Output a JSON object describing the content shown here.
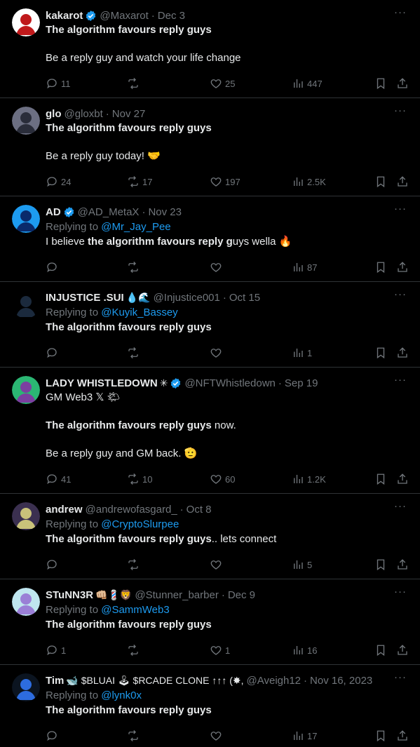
{
  "tweets": [
    {
      "name": "kakarot",
      "emojis": "",
      "verified": true,
      "handle": "@Maxarot",
      "date": "Dec 3",
      "avatar_color": "#c0191b",
      "avatar_bg": "#ffffff",
      "replying_to": "",
      "lines": [
        {
          "segments": [
            {
              "t": "The algorithm favours reply guys",
              "b": true
            }
          ]
        },
        {
          "segments": []
        },
        {
          "segments": [
            {
              "t": "Be a reply guy and watch your life change",
              "b": false
            }
          ]
        }
      ],
      "replies": "11",
      "reposts": "",
      "likes": "25",
      "views": "447"
    },
    {
      "name": "glo",
      "emojis": "",
      "verified": false,
      "handle": "@gloxbt",
      "date": "Nov 27",
      "avatar_color": "#2a2d3a",
      "avatar_bg": "#6c6f82",
      "replying_to": "",
      "lines": [
        {
          "segments": [
            {
              "t": "The algorithm favours reply guys",
              "b": true
            }
          ]
        },
        {
          "segments": []
        },
        {
          "segments": [
            {
              "t": "Be a reply guy today! 🤝",
              "b": false
            }
          ]
        }
      ],
      "replies": "24",
      "reposts": "17",
      "likes": "197",
      "views": "2.5K"
    },
    {
      "name": "AD",
      "emojis": "",
      "verified": true,
      "handle": "@AD_MetaX",
      "date": "Nov 23",
      "avatar_color": "#0a2a6b",
      "avatar_bg": "#1d9bf0",
      "replying_to": "@Mr_Jay_Pee",
      "lines": [
        {
          "segments": [
            {
              "t": "I believe ",
              "b": false
            },
            {
              "t": "the algorithm favours reply g",
              "b": true
            },
            {
              "t": "uys wella 🔥",
              "b": false
            }
          ]
        }
      ],
      "replies": "",
      "reposts": "",
      "likes": "",
      "views": "87"
    },
    {
      "name": "INJUSTICE .SUI",
      "emojis": "💧🌊",
      "verified": false,
      "handle": "@Injustice001",
      "date": "Oct 15",
      "avatar_color": "#1b2a3d",
      "avatar_bg": "#000000",
      "replying_to": "@Kuyik_Bassey",
      "lines": [
        {
          "segments": [
            {
              "t": "The algorithm favours reply guys",
              "b": true
            }
          ]
        }
      ],
      "replies": "",
      "reposts": "",
      "likes": "",
      "views": "1"
    },
    {
      "name": "LADY WHISTLEDOWN",
      "emojis": "✳",
      "verified": true,
      "handle": "@NFTWhistledown",
      "date": "Sep 19",
      "avatar_color": "#7b3fa0",
      "avatar_bg": "#2bb673",
      "replying_to": "",
      "lines": [
        {
          "segments": [
            {
              "t": "GM Web3 𝕏 🌤",
              "b": false
            }
          ]
        },
        {
          "segments": []
        },
        {
          "segments": [
            {
              "t": "The algorithm favours reply guys",
              "b": true
            },
            {
              "t": " now.",
              "b": false
            }
          ]
        },
        {
          "segments": []
        },
        {
          "segments": [
            {
              "t": "Be a reply guy and GM back. 🫡",
              "b": false
            }
          ]
        }
      ],
      "replies": "41",
      "reposts": "10",
      "likes": "60",
      "views": "1.2K"
    },
    {
      "name": "andrew",
      "emojis": "",
      "verified": false,
      "handle": "@andrewofasgard_",
      "date": "Oct 8",
      "avatar_color": "#c9c27a",
      "avatar_bg": "#3b3050",
      "replying_to": "@CryptoSlurpee",
      "lines": [
        {
          "segments": [
            {
              "t": "The algorithm favours reply guys",
              "b": true
            },
            {
              "t": ".. lets connect",
              "b": false
            }
          ]
        }
      ],
      "replies": "",
      "reposts": "",
      "likes": "",
      "views": "5"
    },
    {
      "name": "STuNN3R",
      "emojis": "👊🏼💈🦁",
      "verified": false,
      "handle": "@Stunner_barber",
      "date": "Dec 9",
      "avatar_color": "#9a7fd6",
      "avatar_bg": "#bfe6ef",
      "replying_to": "@SammWeb3",
      "lines": [
        {
          "segments": [
            {
              "t": "The algorithm favours reply guys",
              "b": true
            }
          ]
        }
      ],
      "replies": "1",
      "reposts": "",
      "likes": "1",
      "views": "16"
    },
    {
      "name": "Tim",
      "emojis": "🐋 $BLUAI 🕹 $RCADE CLONE ↑↑↑ (✸,",
      "verified": false,
      "handle": "@Aveigh12",
      "date": "Nov 16, 2023",
      "avatar_color": "#2d6cdf",
      "avatar_bg": "#0b1420",
      "replying_to": "@lynk0x",
      "lines": [
        {
          "segments": [
            {
              "t": "The algorithm favours reply guys",
              "b": true
            }
          ]
        }
      ],
      "replies": "",
      "reposts": "",
      "likes": "",
      "views": "17"
    }
  ],
  "labels": {
    "replying_prefix": "Replying to "
  },
  "colors": {
    "accent": "#1d9bf0",
    "muted": "#71767b",
    "text": "#e7e9ea",
    "divider": "#2f3336"
  }
}
